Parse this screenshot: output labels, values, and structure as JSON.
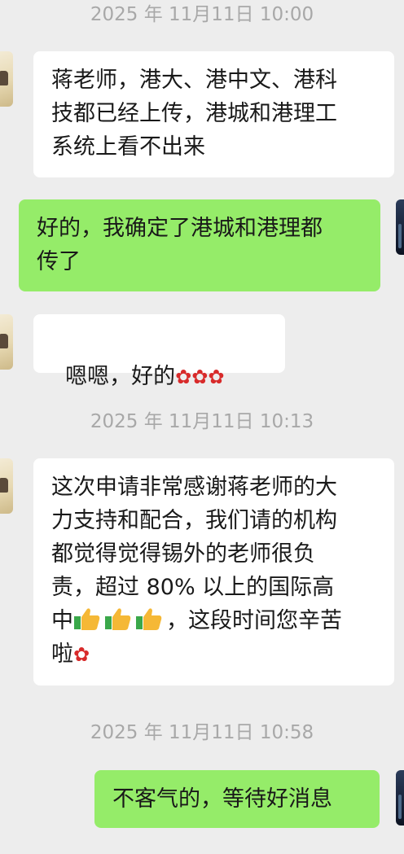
{
  "chat": {
    "ts1": "2025 年 11月11日 10:00",
    "ts2": "2025 年 11月11日 10:13",
    "ts3": "2025 年 11月11日 10:58",
    "msg1": "蒋老师，港大、港中文、港科\n技都已经上传，港城和港理工\n系统上看不出来",
    "msg2": "好的，我确定了港城和港理都\n传了",
    "msg3_text": "嗯嗯，好的",
    "msg4_part1": "这次申请非常感谢蒋老师的大\n力支持和配合，我们请的机构\n都觉得觉得锡外的老师很负\n责，超过 80% 以上的国际高\n中",
    "msg4_part2": "，这段时间您辛苦\n啦",
    "msg5": "不客气的，等待好消息",
    "emoji": {
      "rose": "🌹",
      "thumbs": "👍"
    }
  }
}
